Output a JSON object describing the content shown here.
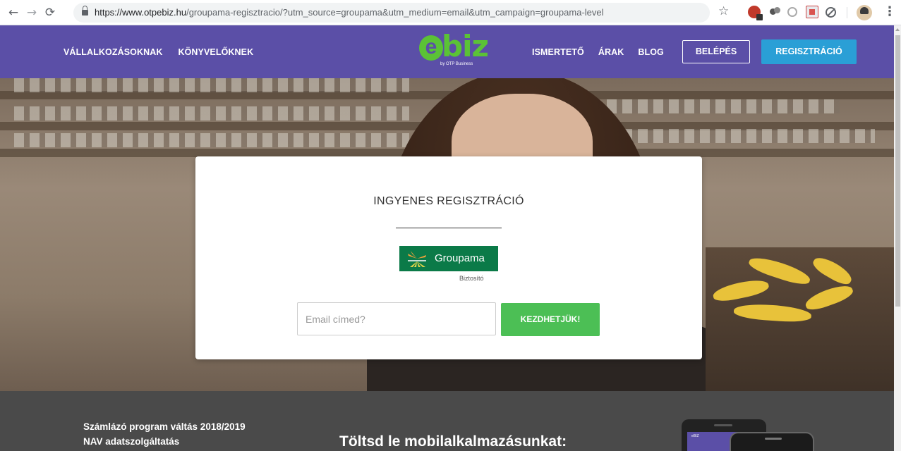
{
  "browser": {
    "url_host": "https://www.otpebiz.hu",
    "url_rest": "/groupama-regisztracio/?utm_source=groupama&utm_medium=email&utm_campaign=groupama-level",
    "icons": [
      "back-arrow-icon",
      "forward-arrow-icon",
      "reload-icon",
      "lock-icon",
      "bookmark-star-icon",
      "extension-icon",
      "kebab-menu-icon"
    ]
  },
  "header": {
    "nav_left": [
      "VÁLLALKOZÁSOKNAK",
      "KÖNYVELŐKNEK"
    ],
    "logo_main": "biz",
    "logo_e": "e",
    "logo_sub": "by OTP Business",
    "nav_right": [
      "ISMERTETŐ",
      "ÁRAK",
      "BLOG"
    ],
    "login_label": "BELÉPÉS",
    "register_label": "REGISZTRÁCIÓ",
    "bg_color": "#5b4fa7",
    "accent_color": "#2a9fd6"
  },
  "card": {
    "title": "INGYENES REGISZTRÁCIÓ",
    "partner_logo_text": "Groupama",
    "partner_sub": "Biztosító",
    "email_placeholder": "Email címed?",
    "start_label": "KEZDHETJÜK!",
    "start_color": "#4cbf55"
  },
  "footer": {
    "line1": "Számlázó program váltás 2018/2019",
    "line2": "NAV adatszolgáltatás",
    "app_heading": "Töltsd le mobilalkalmazásunkat:",
    "phone_label": "eBIZ"
  }
}
